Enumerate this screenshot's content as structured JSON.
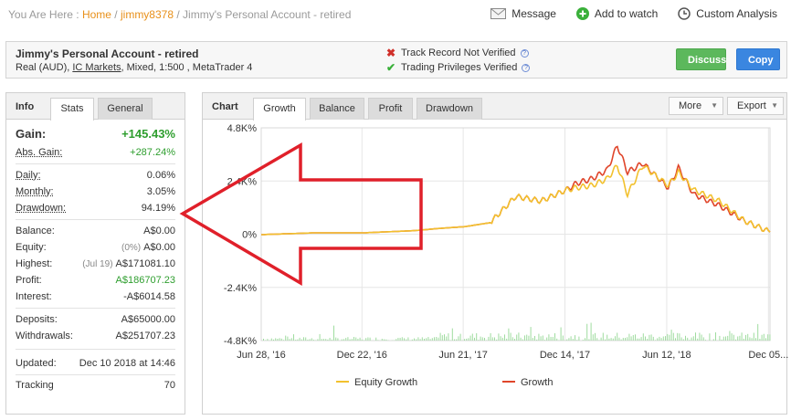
{
  "breadcrumb": {
    "prefix": "You Are Here : ",
    "home": "Home",
    "sep1": " / ",
    "user": "jimmy8378",
    "sep2": " / ",
    "page": "Jimmy's Personal Account - retired"
  },
  "toplinks": {
    "message": "Message",
    "watch": "Add to watch",
    "analysis": "Custom Analysis"
  },
  "account": {
    "title": "Jimmy's Personal Account - retired",
    "currency": "Real (AUD), ",
    "broker": "IC Markets",
    "details": ", Mixed, 1:500 , MetaTrader 4",
    "track_record": "Track Record Not Verified",
    "privileges": "Trading Privileges Verified",
    "help": "?",
    "discuss": "Discuss",
    "copy": "Copy"
  },
  "info": {
    "title": "Info",
    "tabs": [
      "Stats",
      "General"
    ],
    "gain_label": "Gain:",
    "gain": "+145.43%",
    "abs_gain_label": "Abs. Gain:",
    "abs_gain": "+287.24%",
    "daily_label": "Daily:",
    "daily": "0.06%",
    "monthly_label": "Monthly:",
    "monthly": "3.05%",
    "drawdown_label": "Drawdown:",
    "drawdown": "94.19%",
    "balance_label": "Balance:",
    "balance": "A$0.00",
    "equity_label": "Equity:",
    "equity_pct": "(0%)",
    "equity": "A$0.00",
    "highest_label": "Highest:",
    "highest_date": "(Jul 19)",
    "highest": "A$171081.10",
    "profit_label": "Profit:",
    "profit": "A$186707.23",
    "interest_label": "Interest:",
    "interest": "-A$6014.58",
    "deposits_label": "Deposits:",
    "deposits": "A$65000.00",
    "withdrawals_label": "Withdrawals:",
    "withdrawals": "A$251707.23",
    "updated_label": "Updated:",
    "updated": "Dec 10 2018 at 14:46",
    "tracking_label": "Tracking",
    "tracking": "70"
  },
  "chart_panel": {
    "title": "Chart",
    "tabs": [
      "Growth",
      "Balance",
      "Profit",
      "Drawdown"
    ],
    "more": "More",
    "export": "Export"
  },
  "chart_data": {
    "type": "line",
    "y_ticks": [
      "4.8K%",
      "2.4K%",
      "0%",
      "-2.4K%",
      "-4.8K%"
    ],
    "x_ticks": [
      "Jun 28, '16",
      "Dec 22, '16",
      "Jun 21, '17",
      "Dec 14, '17",
      "Jun 12, '18",
      "Dec 05..."
    ],
    "ylim": [
      -4800,
      4800
    ],
    "legend_position": "bottom",
    "series": [
      {
        "name": "Equity Growth",
        "color": "#f2c12e",
        "x": [
          0,
          0.1,
          0.2,
          0.3,
          0.35,
          0.4,
          0.45,
          0.5,
          0.55,
          0.6,
          0.62,
          0.65,
          0.68,
          0.7,
          0.72,
          0.75,
          0.8,
          0.82,
          0.85,
          0.9,
          0.95,
          1.0
        ],
        "y": [
          -20,
          60,
          60,
          160,
          260,
          340,
          520,
          1700,
          1500,
          2000,
          2100,
          2200,
          2500,
          3100,
          1800,
          3100,
          2200,
          2800,
          2000,
          1500,
          600,
          100
        ]
      },
      {
        "name": "Growth",
        "color": "#e0452a",
        "x": [
          0,
          0.1,
          0.2,
          0.3,
          0.35,
          0.4,
          0.45,
          0.5,
          0.55,
          0.6,
          0.62,
          0.65,
          0.68,
          0.7,
          0.72,
          0.75,
          0.8,
          0.82,
          0.85,
          0.9,
          0.95,
          1.0
        ],
        "y": [
          -20,
          60,
          60,
          160,
          260,
          340,
          520,
          1700,
          1500,
          2000,
          2300,
          2500,
          2900,
          4000,
          2800,
          3200,
          2100,
          3000,
          1800,
          1300,
          600,
          100
        ]
      }
    ]
  },
  "colors": {
    "link": "#e8901a",
    "green": "#2e9e2e",
    "red_x": "#d0302a",
    "discuss": "#5cb85c",
    "copy": "#3a86e0",
    "arrow": "#e0202a"
  },
  "icons": {
    "message": "envelope-icon",
    "watch": "plus-circle-icon",
    "analysis": "clock-icon"
  }
}
